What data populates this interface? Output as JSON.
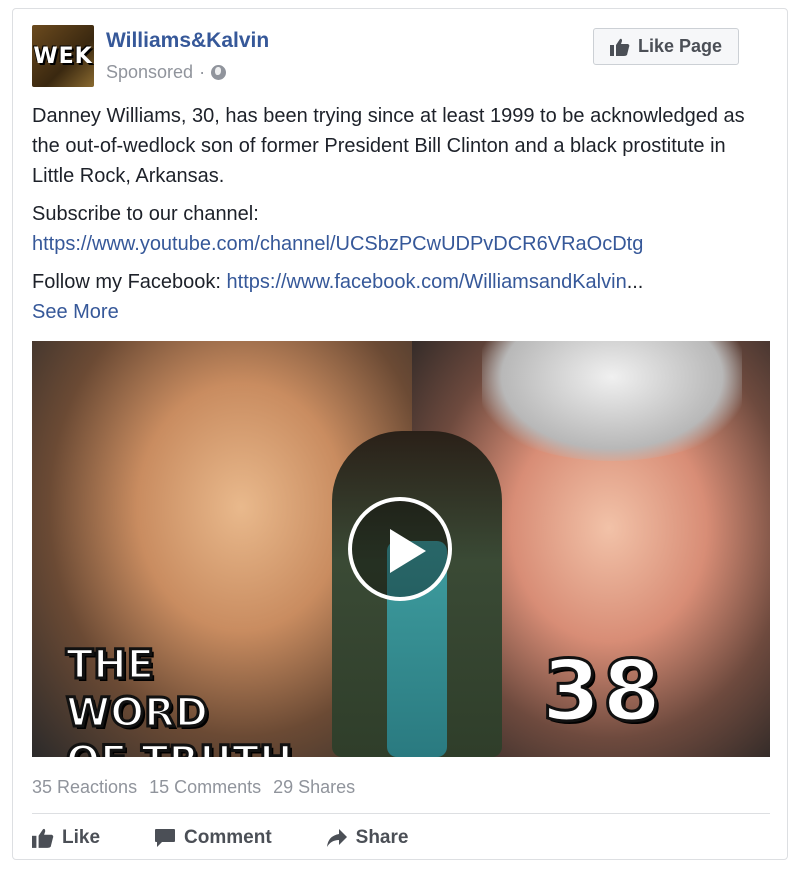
{
  "header": {
    "avatar_text": "WEK",
    "page_name": "Williams&Kalvin",
    "sponsored_label": "Sponsored",
    "separator": "·",
    "privacy_icon": "globe-icon",
    "like_page_label": "Like Page",
    "like_page_icon": "thumbs-up-icon"
  },
  "post": {
    "paragraph1": "Danney Williams, 30, has been trying since at least 1999 to be acknowledged as the out-of-wedlock son of former President Bill Clinton and a black prostitute in Little Rock, Arkansas.",
    "subscribe_label": "Subscribe to our channel:",
    "subscribe_url": "https://www.youtube.com/channel/UCSbzPCwUDPvDCR6VRaOcDtg",
    "follow_label": "Follow my Facebook:",
    "follow_url": "https://www.facebook.com/WilliamsandKalvin",
    "ellipsis": "...",
    "see_more": "See More"
  },
  "video": {
    "overlay_title_line1": "THE WORD",
    "overlay_title_line2": "OF TRUTH",
    "overlay_number": "38",
    "play_icon": "play-icon"
  },
  "stats": {
    "reactions": "35 Reactions",
    "comments": "15 Comments",
    "shares": "29 Shares"
  },
  "actions": {
    "like": "Like",
    "comment": "Comment",
    "share": "Share"
  },
  "colors": {
    "link": "#365899",
    "text": "#1d2129",
    "muted": "#90949c",
    "border": "#dddfe2"
  }
}
